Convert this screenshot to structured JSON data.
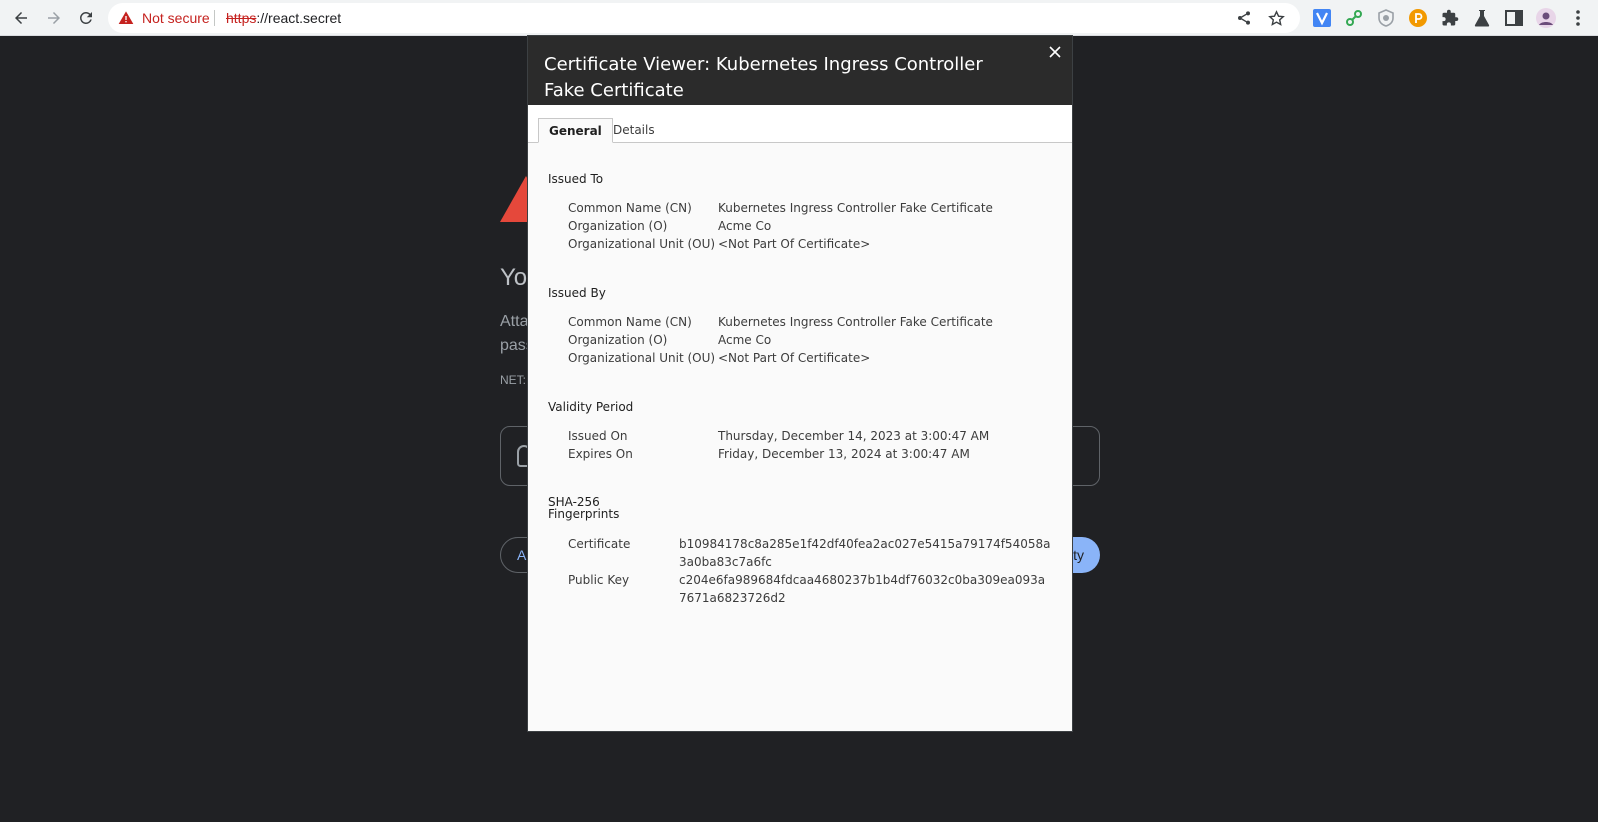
{
  "browser": {
    "not_secure_label": "Not secure",
    "url_scheme": "https",
    "url_rest": "://react.secret"
  },
  "error_page": {
    "heading": "Yo",
    "line1": "Atta",
    "line2": "pass",
    "code": "NET:",
    "advanced_button": "Ad",
    "back_button": "ty"
  },
  "dialog": {
    "title": "Certificate Viewer: Kubernetes Ingress Controller Fake Certificate",
    "tabs": [
      {
        "label": "General",
        "active": true
      },
      {
        "label": "Details",
        "active": false
      }
    ],
    "issued_to": {
      "title": "Issued To",
      "fields": [
        {
          "label": "Common Name (CN)",
          "value": "Kubernetes Ingress Controller Fake Certificate"
        },
        {
          "label": "Organization (O)",
          "value": "Acme Co"
        },
        {
          "label": "Organizational Unit (OU)",
          "value": "<Not Part Of Certificate>"
        }
      ]
    },
    "issued_by": {
      "title": "Issued By",
      "fields": [
        {
          "label": "Common Name (CN)",
          "value": "Kubernetes Ingress Controller Fake Certificate"
        },
        {
          "label": "Organization (O)",
          "value": "Acme Co"
        },
        {
          "label": "Organizational Unit (OU)",
          "value": "<Not Part Of Certificate>"
        }
      ]
    },
    "validity": {
      "title": "Validity Period",
      "fields": [
        {
          "label": "Issued On",
          "value": "Thursday, December 14, 2023 at 3:00:47 AM"
        },
        {
          "label": "Expires On",
          "value": "Friday, December 13, 2024 at 3:00:47 AM"
        }
      ]
    },
    "fingerprints": {
      "title_line1": "SHA-256",
      "title_line2": "Fingerprints",
      "fields": [
        {
          "label": "Certificate",
          "value": "b10984178c8a285e1f42df40fea2ac027e5415a79174f54058a3a0ba83c7a6fc"
        },
        {
          "label": "Public Key",
          "value": "c204e6fa989684fdcaa4680237b1b4df76032c0ba309ea093a7671a6823726d2"
        }
      ]
    }
  },
  "icons": {
    "back": "back-arrow-icon",
    "forward": "forward-arrow-icon",
    "reload": "reload-icon",
    "warning": "warning-triangle-icon",
    "share": "share-icon",
    "bookmark": "star-icon",
    "close": "close-icon"
  },
  "colors": {
    "not_secure_red": "#c5221f",
    "dialog_header": "#2b2b2b",
    "page_background": "#202124",
    "primary_button": "#8ab4f8"
  }
}
